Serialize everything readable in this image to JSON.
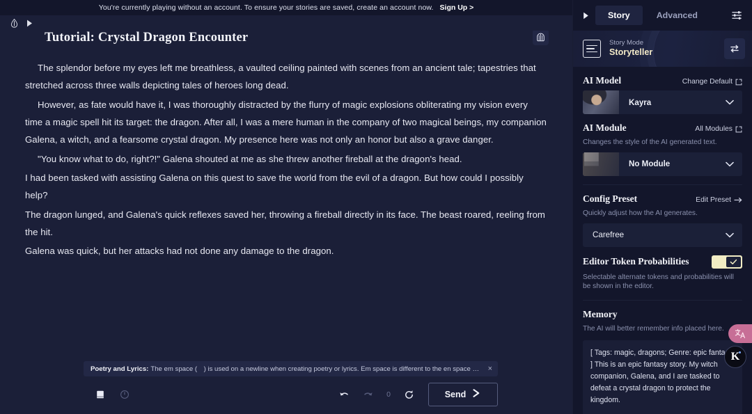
{
  "banner": {
    "text": "You're currently playing without an account. To ensure your stories are saved, create an account now.",
    "link": "Sign Up >"
  },
  "toolbar_icons": {
    "flask": "flask-icon",
    "play": "play-icon"
  },
  "story": {
    "title": "Tutorial: Crystal Dragon Encounter",
    "title_icon": "lorebook-icon",
    "paragraphs": [
      "The splendor before my eyes left me breathless, a vaulted ceiling painted with scenes from an ancient tale; tapestries that stretched across three walls depicting tales of heroes long dead.",
      "However, as fate would have it, I was thoroughly distracted by the flurry of magic explosions obliterating my vision every time a magic spell hit its target: the dragon. After all, I was a mere human in the company of two magical beings, my companion Galena, a witch, and a fearsome crystal dragon. My presence here was not only an honor but also a grave danger.",
      "\"You know what to do, right?!\" Galena shouted at me as she threw another fireball at the dragon's head.",
      "I had been tasked with assisting Galena on this quest to save the world from the evil of a dragon. But how could I possibly help?",
      "The dragon lunged, and Galena's quick reflexes saved her, throwing a fireball directly in its face. The beast roared, reeling from the hit.",
      "Galena was quick, but her attacks had not done any damage to the dragon."
    ]
  },
  "hint": {
    "label": "Poetry and Lyrics:",
    "body": "The em space ( ) is used on a newline when creating poetry or lyrics. Em space is different to the en space a…",
    "close": "×"
  },
  "action_bar": {
    "lorebook_icon": "book-icon",
    "power_icon": "power-icon",
    "undo_icon": "undo-icon",
    "redo_icon": "redo-icon",
    "retry_icon": "retry-icon",
    "counter": "0",
    "send_label": "Send",
    "send_icon": "send-arrow-icon"
  },
  "sidebar": {
    "collapse_icon": "chevron-right-icon",
    "tabs": [
      {
        "label": "Story",
        "active": true
      },
      {
        "label": "Advanced",
        "active": false
      }
    ],
    "settings_icon": "sliders-icon",
    "story_mode": {
      "label": "Story Mode",
      "value": "Storyteller",
      "icon": "document-lines-icon",
      "swap_icon": "swap-arrows-icon"
    },
    "ai_model": {
      "title": "AI Model",
      "action": "Change Default",
      "action_icon": "external-link-icon",
      "value": "Kayra",
      "caret": "chevron-down-icon"
    },
    "ai_module": {
      "title": "AI Module",
      "action": "All Modules",
      "action_icon": "external-link-icon",
      "description": "Changes the style of the AI generated text.",
      "value": "No Module",
      "caret": "chevron-down-icon"
    },
    "config_preset": {
      "title": "Config Preset",
      "action": "Edit Preset",
      "action_icon": "arrow-right-icon",
      "description": "Quickly adjust how the AI generates.",
      "value": "Carefree",
      "caret": "chevron-down-icon"
    },
    "token_probabilities": {
      "title": "Editor Token Probabilities",
      "enabled": true,
      "description": "Selectable alternate tokens and probabilities will be shown in the editor."
    },
    "memory": {
      "title": "Memory",
      "description": "The AI will better remember info placed here.",
      "content": "[ Tags: magic, dragons; Genre: epic fantasy ] This is an epic fantasy story. My witch companion, Galena, and I are tasked to defeat a crystal dragon to protect the kingdom."
    },
    "floating": {
      "translate_icon": "translate-icon",
      "badge_letter": "K"
    }
  },
  "colors": {
    "app_bg": "#13162b",
    "editor_bg": "#1b1f38",
    "accent_cream": "#f1ecc4",
    "accent_pink": "#c76e96",
    "text_primary": "#e8e9f2",
    "text_muted": "#8a90ad"
  }
}
